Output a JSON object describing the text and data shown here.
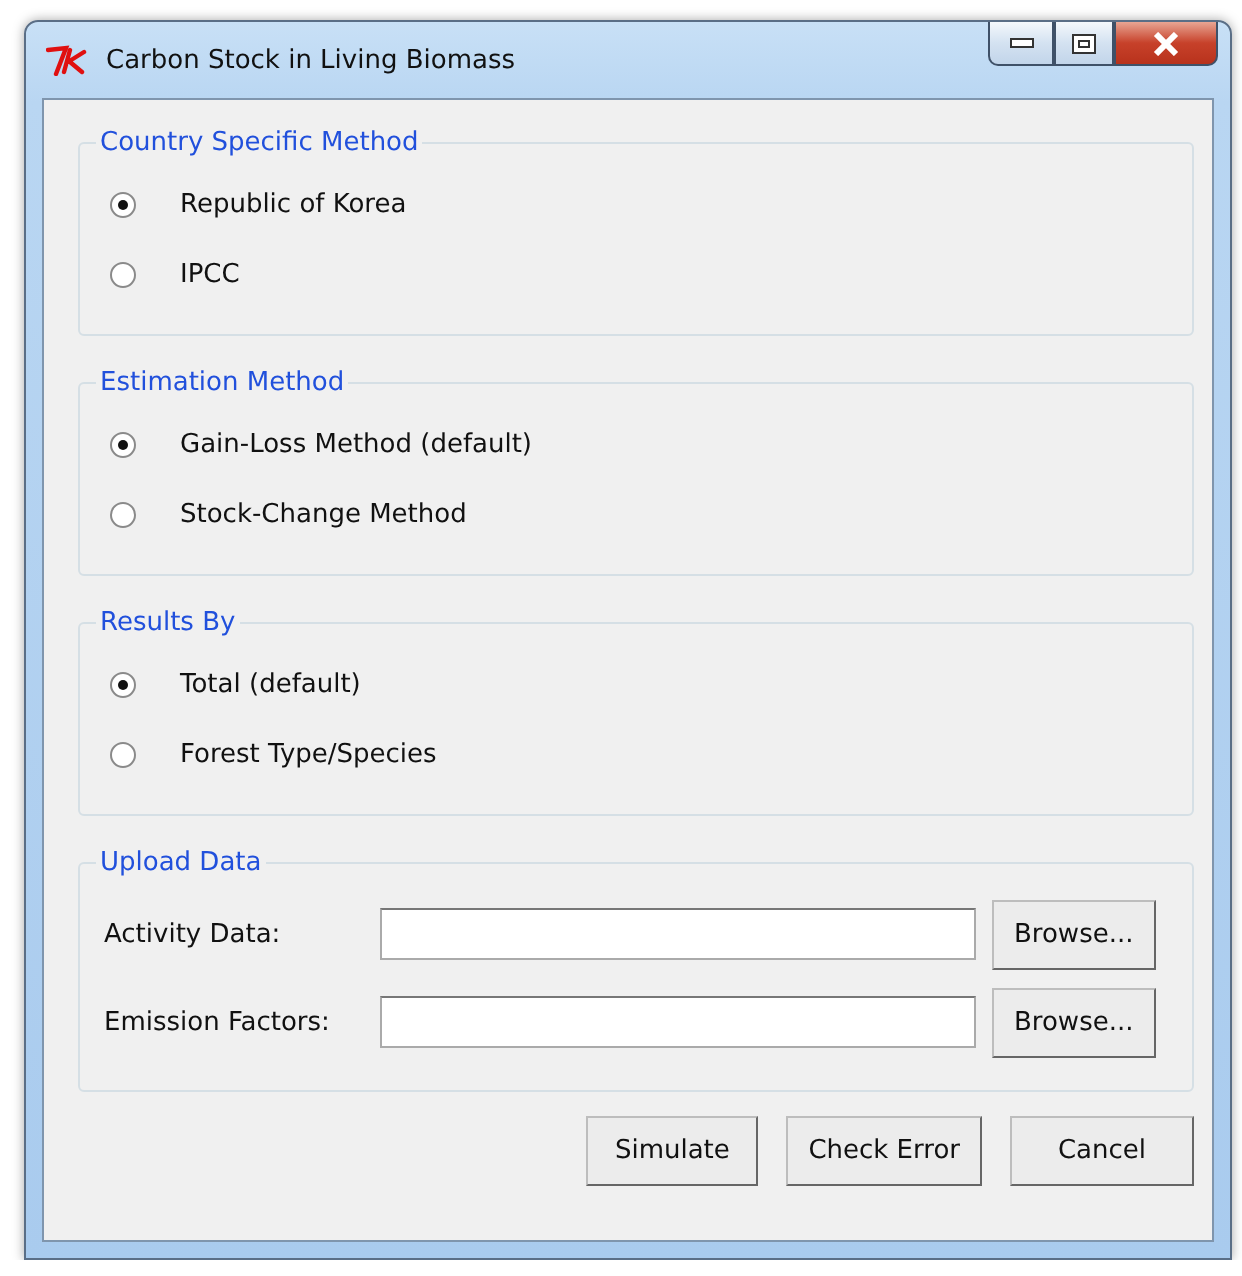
{
  "window": {
    "title": "Carbon Stock in Living Biomass"
  },
  "groups": [
    {
      "title": "Country Specific Method",
      "kind": "radio",
      "options": [
        {
          "label": "Republic of Korea",
          "selected": true
        },
        {
          "label": "IPCC",
          "selected": false
        }
      ]
    },
    {
      "title": "Estimation Method",
      "kind": "radio",
      "options": [
        {
          "label": "Gain-Loss Method (default)",
          "selected": true
        },
        {
          "label": "Stock-Change Method",
          "selected": false
        }
      ]
    },
    {
      "title": "Results By",
      "kind": "radio",
      "options": [
        {
          "label": "Total (default)",
          "selected": true
        },
        {
          "label": "Forest Type/Species",
          "selected": false
        }
      ]
    },
    {
      "title": "Upload Data",
      "kind": "files",
      "fields": [
        {
          "label": "Activity Data:",
          "button": "Browse..."
        },
        {
          "label": "Emission Factors:",
          "button": "Browse..."
        }
      ]
    }
  ],
  "buttons": [
    "Simulate",
    "Check Error",
    "Cancel"
  ]
}
